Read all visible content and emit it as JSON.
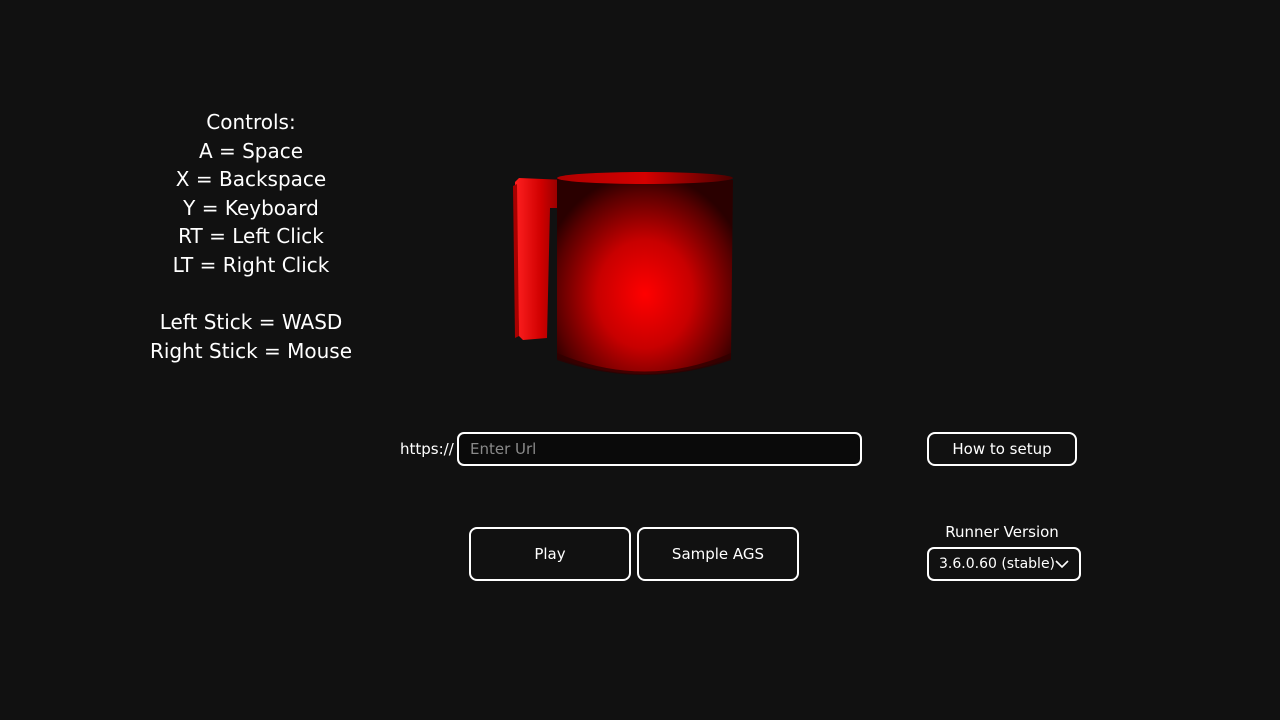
{
  "controls": {
    "title": "Controls:",
    "lines": [
      "A = Space",
      "X = Backspace",
      "Y = Keyboard",
      "RT = Left Click",
      "LT = Right Click"
    ],
    "stick_lines": [
      "Left Stick = WASD",
      "Right Stick = Mouse"
    ]
  },
  "url": {
    "prefix": "https://",
    "value": "",
    "placeholder": "Enter Url"
  },
  "buttons": {
    "how_to_setup": "How to setup",
    "play": "Play",
    "sample_ags": "Sample AGS"
  },
  "runner": {
    "label": "Runner Version",
    "selected": "3.6.0.60 (stable)"
  },
  "icons": {
    "mug": "mug-3d-model-icon",
    "dropdown": "chevron-down-icon"
  },
  "colors": {
    "background": "#111111",
    "text": "#ffffff",
    "mug": "#e00000"
  }
}
